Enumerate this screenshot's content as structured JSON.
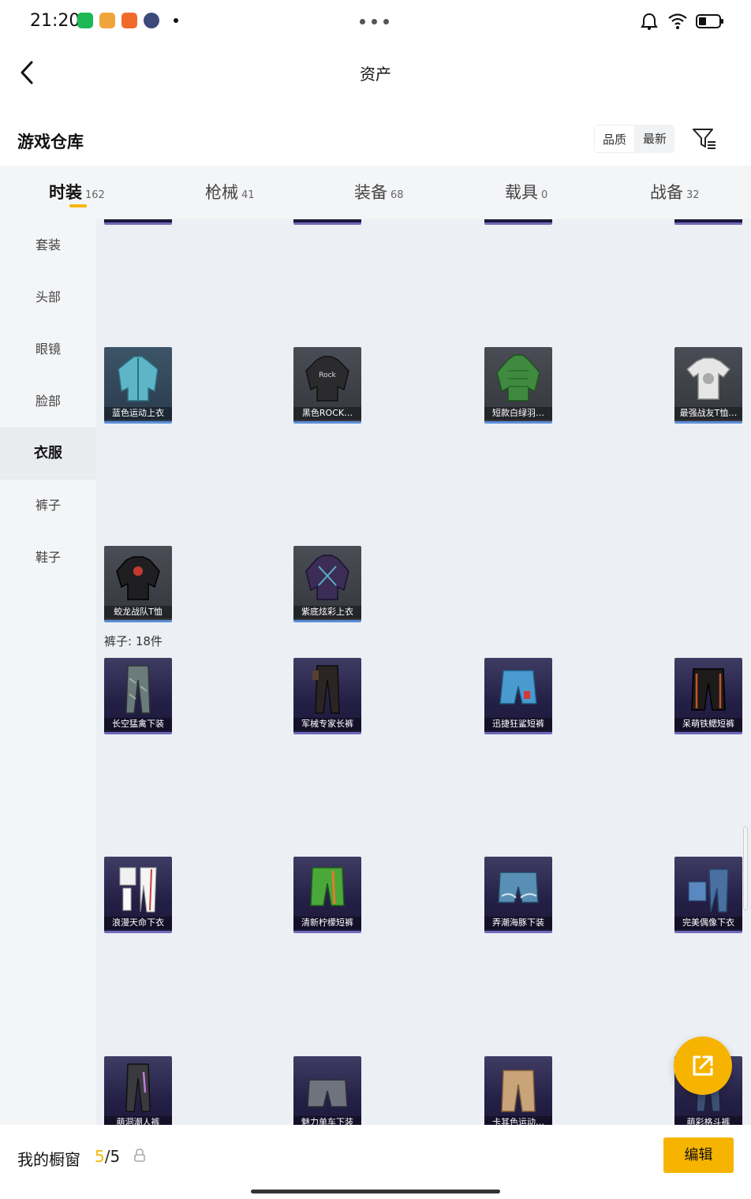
{
  "status_bar": {
    "time": "21:20"
  },
  "header": {
    "title": "资产"
  },
  "warehouse": {
    "title": "游戏仓库",
    "sort_quality": "品质",
    "sort_newest": "最新"
  },
  "category_tabs": [
    {
      "label": "时装",
      "count": "162"
    },
    {
      "label": "枪械",
      "count": "41"
    },
    {
      "label": "装备",
      "count": "68"
    },
    {
      "label": "载具",
      "count": "0"
    },
    {
      "label": "战备",
      "count": "32"
    }
  ],
  "sidebar": [
    {
      "label": "套装"
    },
    {
      "label": "头部"
    },
    {
      "label": "眼镜"
    },
    {
      "label": "脸部"
    },
    {
      "label": "衣服"
    },
    {
      "label": "裤子"
    },
    {
      "label": "鞋子"
    }
  ],
  "clothes_items": [
    {
      "name": "蓝色运动上衣"
    },
    {
      "name": "黑色ROCK…"
    },
    {
      "name": "短款白绿羽…"
    },
    {
      "name": "最强战友T恤…"
    },
    {
      "name": "蛟龙战队T恤"
    },
    {
      "name": "紫底炫彩上衣"
    }
  ],
  "pants_section_label": "裤子: 18件",
  "pants_items": [
    {
      "name": "长空猛禽下装"
    },
    {
      "name": "军械专家长裤"
    },
    {
      "name": "迅捷狂鲨短裤"
    },
    {
      "name": "呆萌铁鳃短裤"
    },
    {
      "name": "浪漫天命下衣"
    },
    {
      "name": "清新柠檬短裤"
    },
    {
      "name": "弄潮海豚下装"
    },
    {
      "name": "完美偶像下衣"
    },
    {
      "name": "萌洞潮人裤"
    },
    {
      "name": "魅力单车下装"
    },
    {
      "name": "卡其色运动…"
    },
    {
      "name": "萌彩格斗裤"
    }
  ],
  "bottom": {
    "showcase_label": "我的橱窗",
    "current": "5",
    "total": "/5",
    "edit_label": "编辑"
  },
  "colors": {
    "accent": "#f6b400",
    "active_underline": "#f5b800"
  }
}
